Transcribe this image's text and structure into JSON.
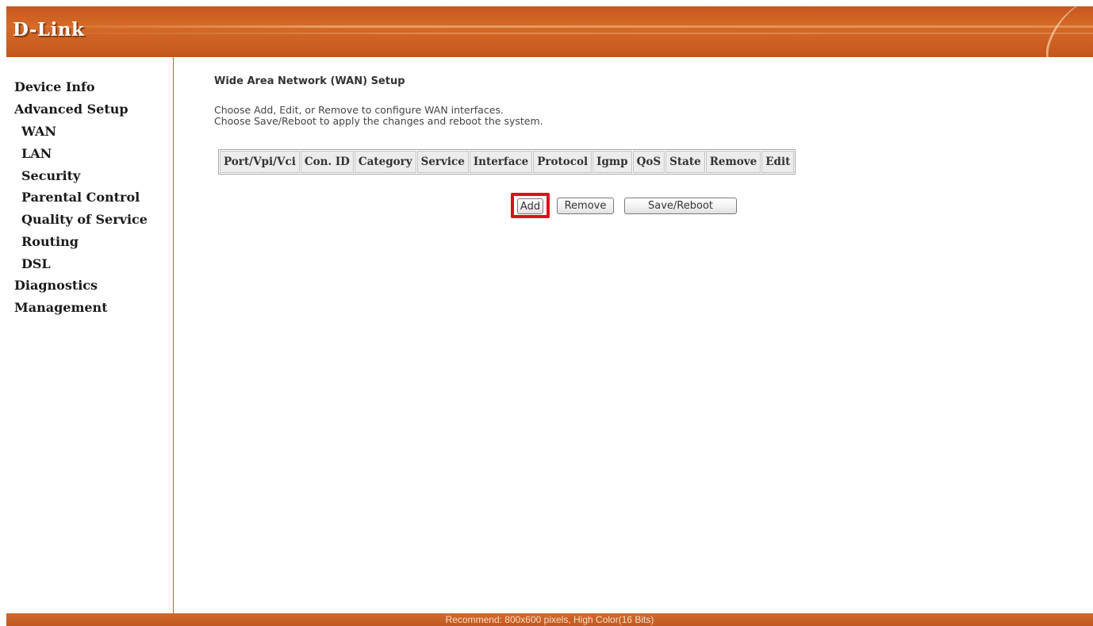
{
  "header": {
    "logo_text": "D-Link"
  },
  "sidebar": {
    "items": [
      {
        "label": "Device Info",
        "level": "top"
      },
      {
        "label": "Advanced Setup",
        "level": "top"
      },
      {
        "label": "WAN",
        "level": "sub"
      },
      {
        "label": "LAN",
        "level": "sub"
      },
      {
        "label": "Security",
        "level": "sub"
      },
      {
        "label": "Parental Control",
        "level": "sub"
      },
      {
        "label": "Quality of Service",
        "level": "sub"
      },
      {
        "label": "Routing",
        "level": "sub"
      },
      {
        "label": "DSL",
        "level": "sub"
      },
      {
        "label": "Diagnostics",
        "level": "top"
      },
      {
        "label": "Management",
        "level": "top"
      }
    ]
  },
  "main": {
    "title": "Wide Area Network (WAN) Setup",
    "description": [
      "Choose Add, Edit, or Remove to configure WAN interfaces.",
      "Choose Save/Reboot to apply the changes and reboot the system."
    ],
    "table": {
      "columns": [
        "Port/Vpi/Vci",
        "Con. ID",
        "Category",
        "Service",
        "Interface",
        "Protocol",
        "Igmp",
        "QoS",
        "State",
        "Remove",
        "Edit"
      ]
    },
    "buttons": {
      "add": "Add",
      "remove": "Remove",
      "save_reboot": "Save/Reboot"
    },
    "highlight_color": "#dd0f1e"
  },
  "footer": {
    "text": "Recommend: 800x600 pixels, High Color(16 Bits)"
  },
  "colors": {
    "header_bg": "#d06a2e",
    "sidebar_divider": "#b0673a"
  }
}
